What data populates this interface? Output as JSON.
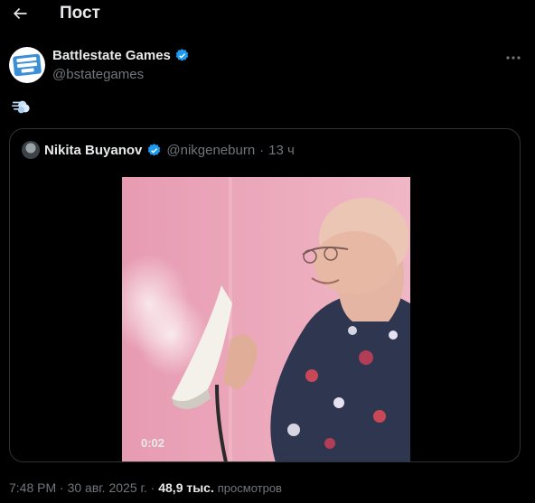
{
  "header": {
    "title": "Пост",
    "back_icon": "arrow-left-icon"
  },
  "author": {
    "name": "Battlestate Games",
    "handle": "@bstategames",
    "verified_icon": "verified-badge-icon",
    "more_icon": "more-horizontal-icon"
  },
  "post": {
    "emoji": "dashing-away-emoji"
  },
  "quoted": {
    "name": "Nikita Buyanov",
    "handle": "@nikgeneburn",
    "separator": "·",
    "time": "13 ч",
    "video_duration": "0:02"
  },
  "meta": {
    "time": "7:48 PM",
    "separator": "·",
    "date": "30 авг. 2025 г.",
    "separator2": "·",
    "views_count": "48,9 тыс.",
    "views_label": "просмотров"
  },
  "colors": {
    "accent": "#1d9bf0",
    "background": "#000000",
    "text": "#e7e9ea",
    "muted": "#71767b"
  }
}
